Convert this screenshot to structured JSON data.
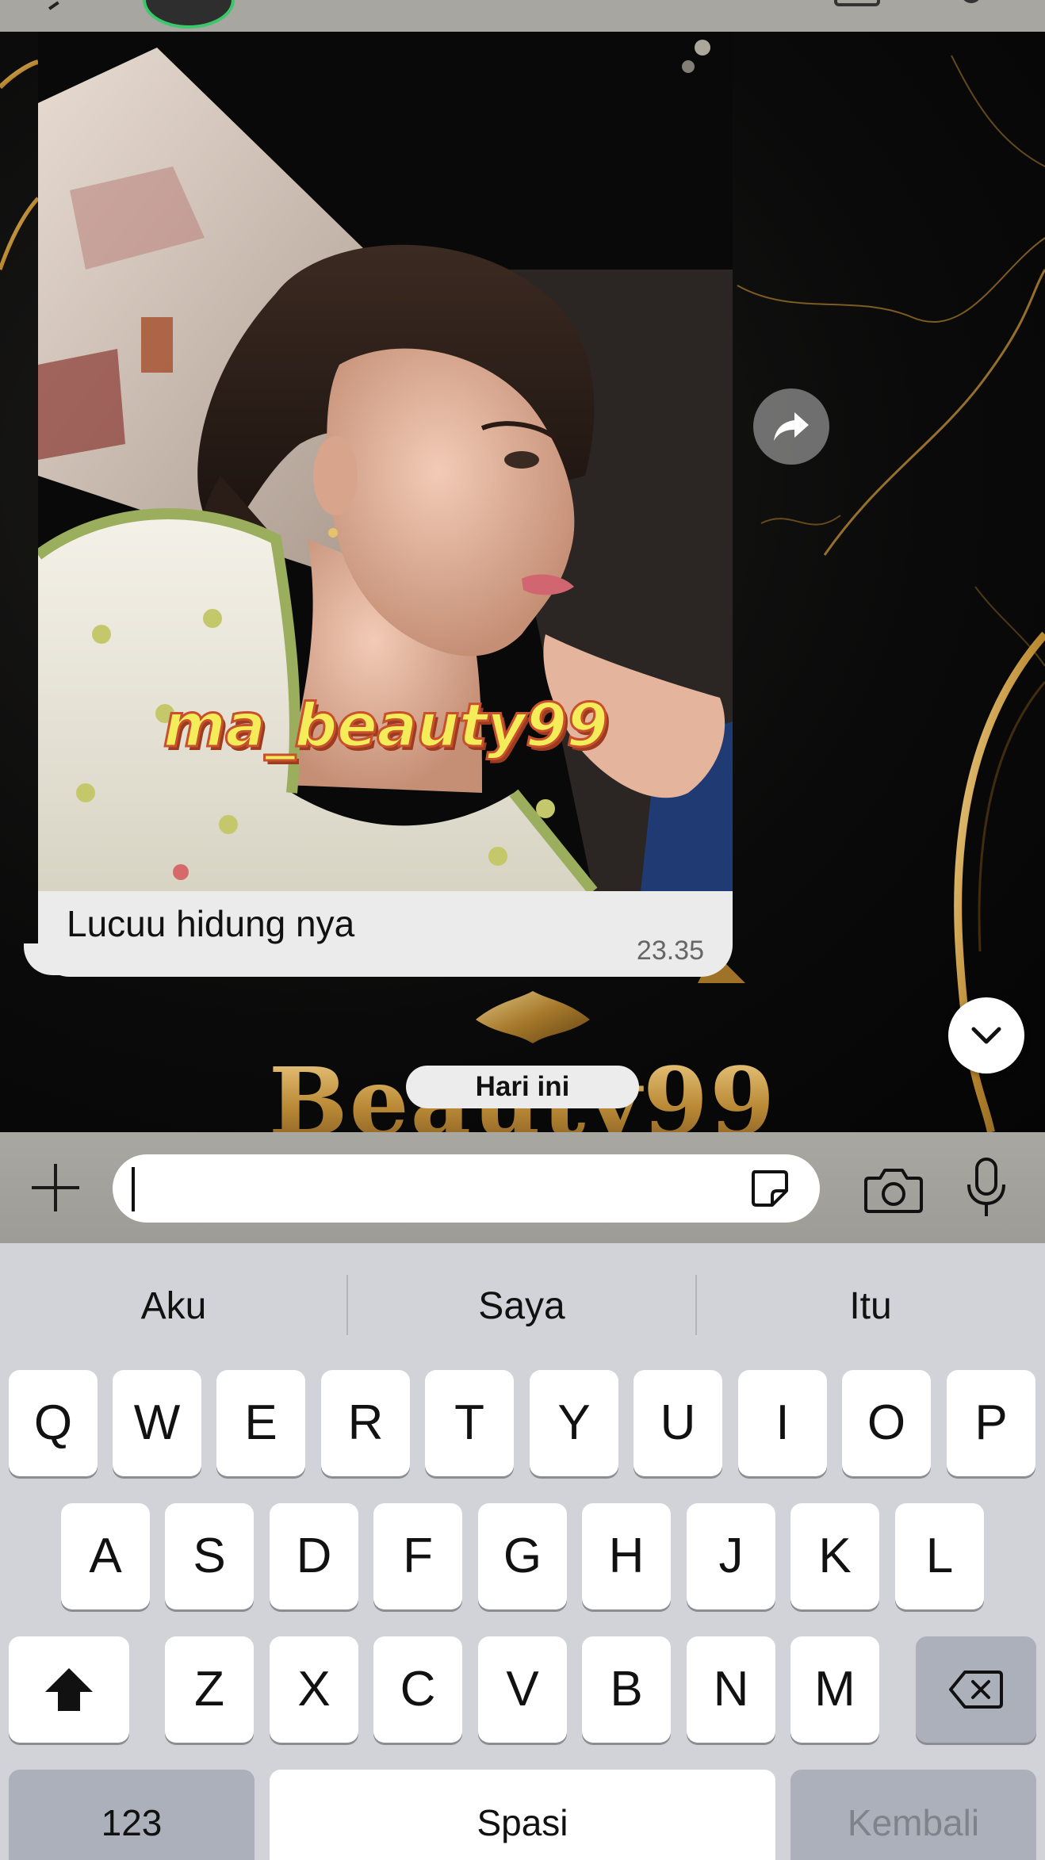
{
  "chat": {
    "photo_caption": "ma_beauty99",
    "message_text": "Lucuu hidung nya",
    "message_time": "23.35",
    "date_separator": "Hari ini",
    "background_brand": "Beauty99"
  },
  "input": {
    "value": "",
    "placeholder": ""
  },
  "icons": {
    "header": [
      "back-chevron-icon",
      "contact-avatar",
      "video-call-icon",
      "voice-call-icon"
    ],
    "chat": [
      "forward-icon",
      "chevron-down-icon"
    ],
    "input_bar": [
      "plus-icon",
      "sticker-icon",
      "camera-icon",
      "microphone-icon"
    ],
    "keyboard": [
      "shift-icon",
      "backspace-icon"
    ]
  },
  "keyboard": {
    "suggestions": [
      "Aku",
      "Saya",
      "Itu"
    ],
    "row1": [
      "Q",
      "W",
      "E",
      "R",
      "T",
      "Y",
      "U",
      "I",
      "O",
      "P"
    ],
    "row2": [
      "A",
      "S",
      "D",
      "F",
      "G",
      "H",
      "J",
      "K",
      "L"
    ],
    "row3": [
      "Z",
      "X",
      "C",
      "V",
      "B",
      "N",
      "M"
    ],
    "numbers_label": "123",
    "space_label": "Spasi",
    "return_label": "Kembali"
  },
  "colors": {
    "bubble": "#ebebec",
    "keyboard_bg": "#d1d3d9",
    "caption_fill": "#f5ec5a",
    "caption_stroke": "#c8502e",
    "brand_gold": "#c9a055",
    "online_ring": "#3cc76a"
  }
}
